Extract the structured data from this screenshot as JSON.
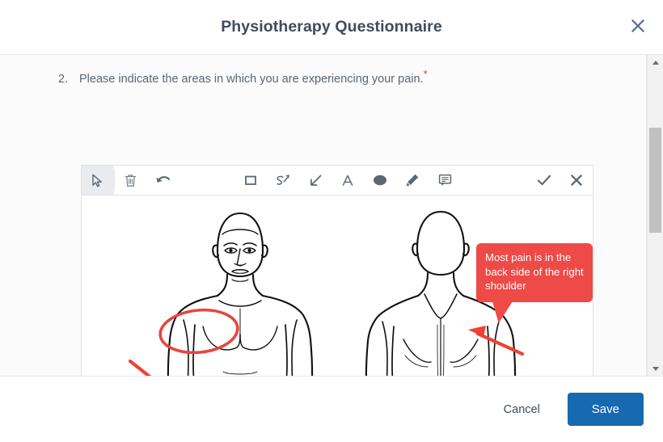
{
  "header": {
    "title": "Physiotherapy Questionnaire",
    "close_icon": "close-x-icon"
  },
  "question": {
    "number": "2.",
    "text": "Please indicate the areas in which you are experiencing your pain.",
    "required_marker": "*"
  },
  "editor": {
    "tools": [
      {
        "id": "select",
        "icon": "cursor-select-icon",
        "label": "Select",
        "active": true
      },
      {
        "id": "delete",
        "icon": "trash-icon",
        "label": "Delete",
        "active": false
      },
      {
        "id": "undo",
        "icon": "undo-arrow-icon",
        "label": "Undo",
        "active": false
      },
      {
        "id": "rectangle",
        "icon": "rectangle-icon",
        "label": "Rectangle",
        "active": false
      },
      {
        "id": "freehand",
        "icon": "scribble-icon",
        "label": "Freehand",
        "active": false
      },
      {
        "id": "arrow",
        "icon": "arrow-icon",
        "label": "Arrow",
        "active": false
      },
      {
        "id": "text",
        "icon": "text-a-icon",
        "label": "Text",
        "active": false
      },
      {
        "id": "ellipse",
        "icon": "ellipse-filled-icon",
        "label": "Ellipse",
        "active": false
      },
      {
        "id": "pen",
        "icon": "pen-icon",
        "label": "Pen",
        "active": false
      },
      {
        "id": "comment",
        "icon": "comment-bubble-icon",
        "label": "Comment",
        "active": false
      },
      {
        "id": "confirm",
        "icon": "check-icon",
        "label": "Confirm",
        "active": false
      },
      {
        "id": "cancel",
        "icon": "x-icon",
        "label": "Cancel",
        "active": false
      }
    ],
    "annotations": {
      "callout_text": "Most pain is in the back side of the right shoulder",
      "callout_color": "#ee4a47",
      "shape_color": "#e8453f",
      "ellipse_label": "front-left-shoulder-ellipse",
      "front_arrow_label": "front-left-arm-arrow",
      "back_arrow_label": "back-right-shoulder-arrow"
    },
    "canvas_label": "body-diagram-front-and-back"
  },
  "footer": {
    "cancel_label": "Cancel",
    "save_label": "Save",
    "save_color": "#1769b0"
  },
  "scrollbar": {
    "up_icon": "scroll-up-arrow-icon",
    "down_icon": "scroll-down-arrow-icon"
  }
}
